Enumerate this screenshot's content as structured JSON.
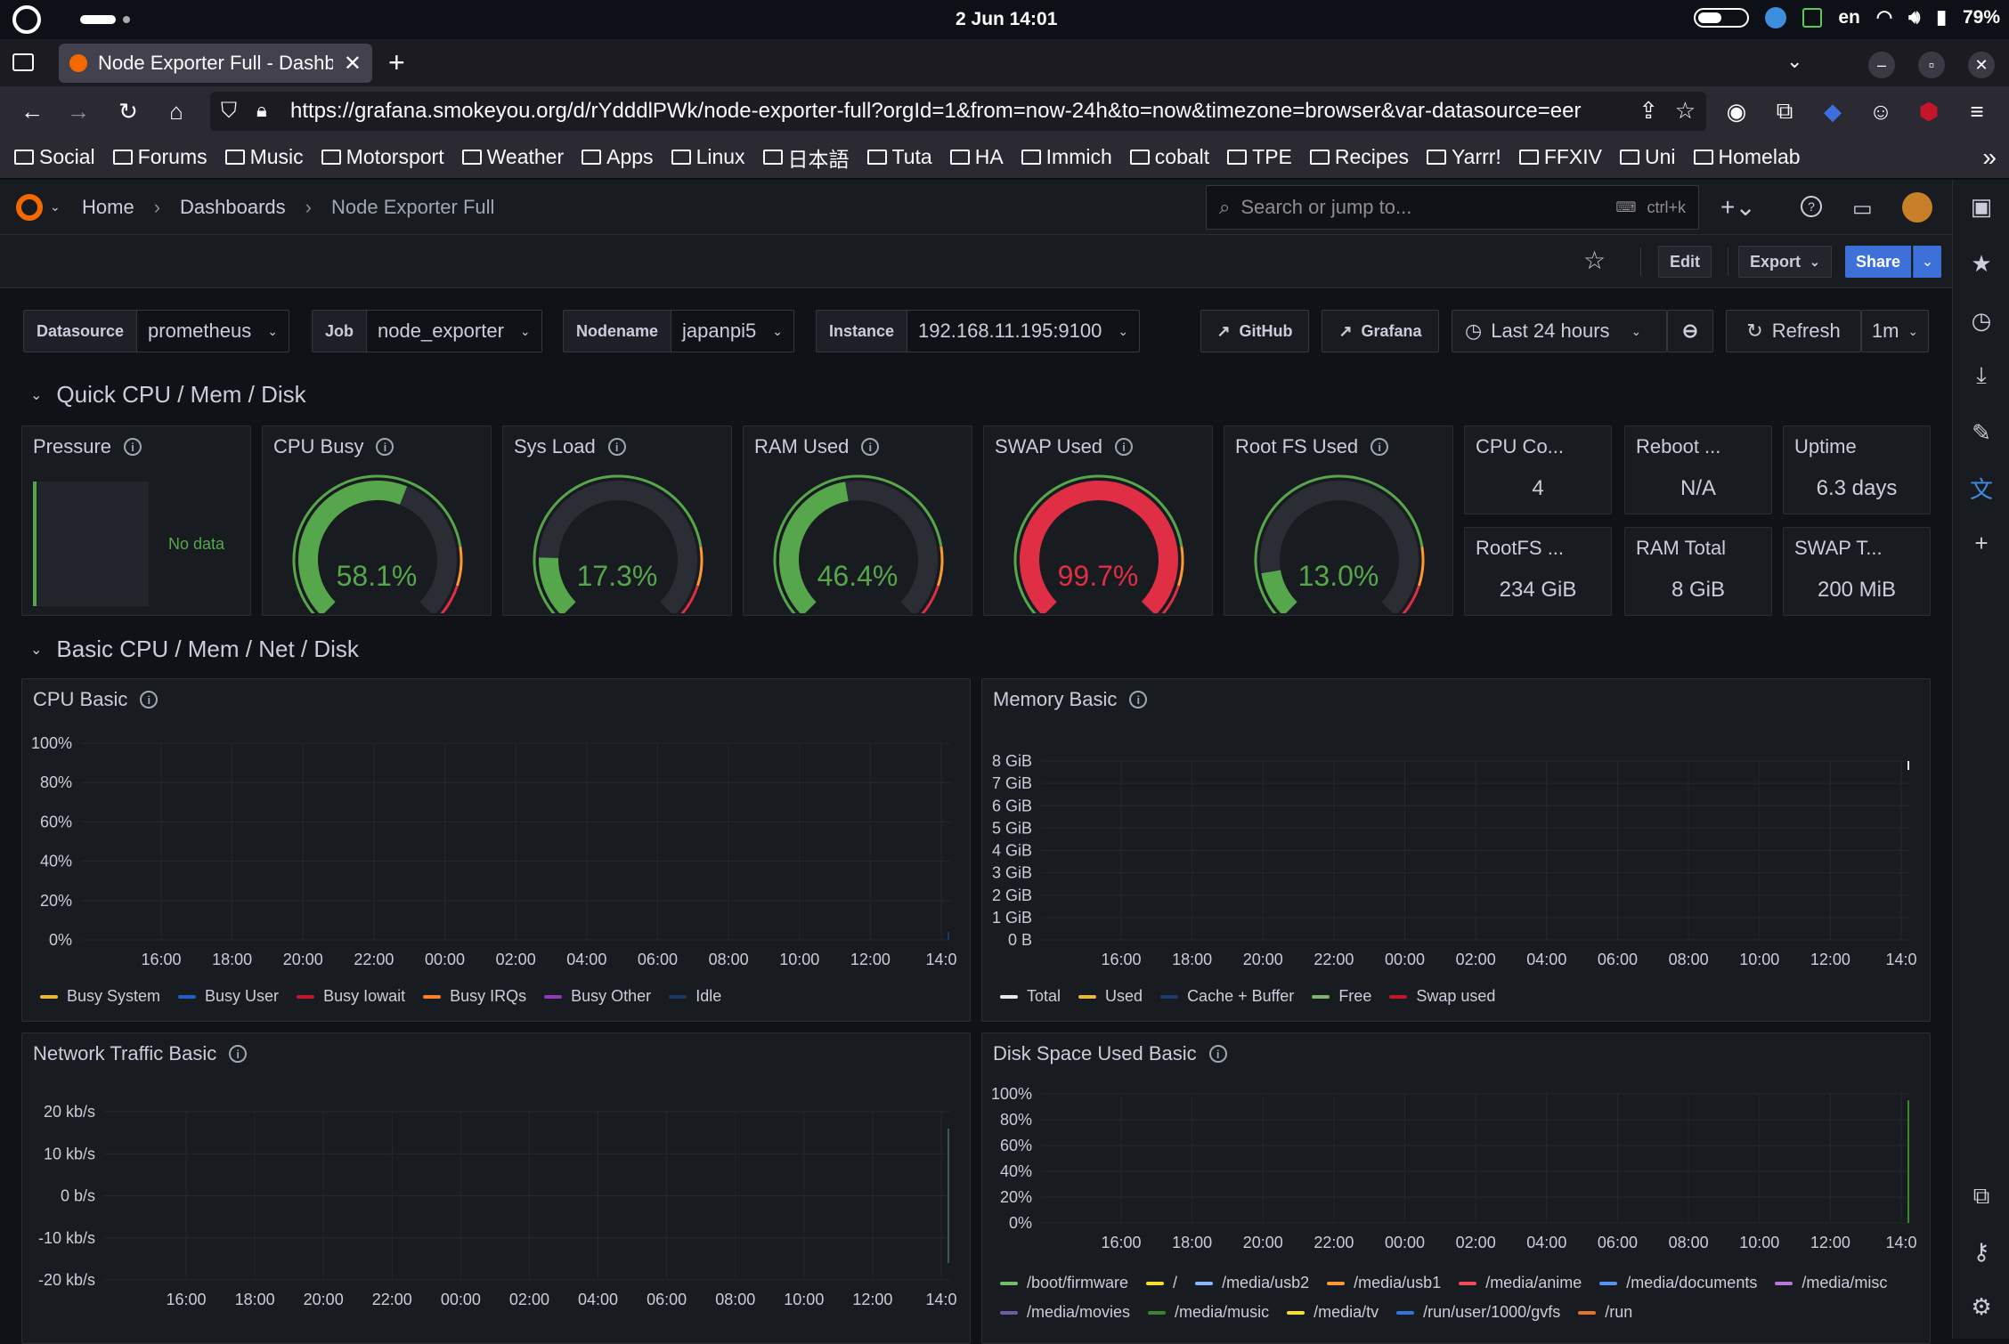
{
  "os": {
    "clock": "2 Jun  14:01",
    "lang": "en",
    "battery": "79%"
  },
  "browser": {
    "tab_title": "Node Exporter Full - Dashb",
    "url": "https://grafana.smokeyou.org/d/rYdddlPWk/node-exporter-full?orgId=1&from=now-24h&to=now&timezone=browser&var-datasource=eer",
    "bookmarks": [
      "Social",
      "Forums",
      "Music",
      "Motorsport",
      "Weather",
      "Apps",
      "Linux",
      "日本語",
      "Tuta",
      "HA",
      "Immich",
      "cobalt",
      "TPE",
      "Recipes",
      "Yarrr!",
      "FFXIV",
      "Uni",
      "Homelab"
    ]
  },
  "grafana": {
    "breadcrumb": [
      "Home",
      "Dashboards",
      "Node Exporter Full"
    ],
    "search_placeholder": "Search or jump to...",
    "search_shortcut": "ctrl+k",
    "edit_label": "Edit",
    "export_label": "Export",
    "share_label": "Share"
  },
  "variables": [
    {
      "label": "Datasource",
      "value": "prometheus"
    },
    {
      "label": "Job",
      "value": "node_exporter"
    },
    {
      "label": "Nodename",
      "value": "japanpi5"
    },
    {
      "label": "Instance",
      "value": "192.168.11.195:9100"
    }
  ],
  "links": {
    "github": "GitHub",
    "grafana": "Grafana"
  },
  "timepicker": {
    "range": "Last 24 hours",
    "refresh": "Refresh",
    "interval": "1m"
  },
  "rows": {
    "quick": "Quick CPU / Mem / Disk",
    "basic": "Basic CPU / Mem / Net / Disk"
  },
  "panels": {
    "pressure": {
      "title": "Pressure",
      "no_data": "No data"
    },
    "gauges": [
      {
        "title": "CPU Busy",
        "value": "58.1%",
        "fraction": 0.581,
        "color": "#56a64b"
      },
      {
        "title": "Sys Load",
        "value": "17.3%",
        "fraction": 0.173,
        "color": "#56a64b"
      },
      {
        "title": "RAM Used",
        "value": "46.4%",
        "fraction": 0.464,
        "color": "#56a64b"
      },
      {
        "title": "SWAP Used",
        "value": "99.7%",
        "fraction": 0.997,
        "color": "#e02f44"
      },
      {
        "title": "Root FS Used",
        "value": "13.0%",
        "fraction": 0.13,
        "color": "#56a64b"
      }
    ],
    "stats": [
      {
        "title": "CPU Co...",
        "value": "4"
      },
      {
        "title": "Reboot ...",
        "value": "N/A"
      },
      {
        "title": "Uptime",
        "value": "6.3 days"
      },
      {
        "title": "RootFS ...",
        "value": "234 GiB"
      },
      {
        "title": "RAM Total",
        "value": "8 GiB"
      },
      {
        "title": "SWAP T...",
        "value": "200 MiB"
      }
    ],
    "cpu_basic": {
      "title": "CPU Basic"
    },
    "memory_basic": {
      "title": "Memory Basic"
    },
    "network_basic": {
      "title": "Network Traffic Basic"
    },
    "disk_basic": {
      "title": "Disk Space Used Basic"
    }
  },
  "chart_data": [
    {
      "type": "line",
      "title": "CPU Basic",
      "x": [
        "16:00",
        "18:00",
        "20:00",
        "22:00",
        "00:00",
        "02:00",
        "04:00",
        "06:00",
        "08:00",
        "10:00",
        "12:00",
        "14:0"
      ],
      "yticks": [
        "100%",
        "80%",
        "60%",
        "40%",
        "20%",
        "0%"
      ],
      "series": [
        {
          "name": "Busy System",
          "color": "#eab839",
          "values": []
        },
        {
          "name": "Busy User",
          "color": "#1f60c4",
          "values": []
        },
        {
          "name": "Busy Iowait",
          "color": "#c4162a",
          "values": []
        },
        {
          "name": "Busy IRQs",
          "color": "#ff7f2a",
          "values": []
        },
        {
          "name": "Busy Other",
          "color": "#8f3bb8",
          "values": []
        },
        {
          "name": "Idle",
          "color": "#1a3a66",
          "values": []
        }
      ]
    },
    {
      "type": "line",
      "title": "Memory Basic",
      "x": [
        "16:00",
        "18:00",
        "20:00",
        "22:00",
        "00:00",
        "02:00",
        "04:00",
        "06:00",
        "08:00",
        "10:00",
        "12:00",
        "14:0"
      ],
      "yticks": [
        "8 GiB",
        "7 GiB",
        "6 GiB",
        "5 GiB",
        "4 GiB",
        "3 GiB",
        "2 GiB",
        "1 GiB",
        "0 B"
      ],
      "series": [
        {
          "name": "Total",
          "color": "#e6e6e6",
          "values": []
        },
        {
          "name": "Used",
          "color": "#eab839",
          "values": []
        },
        {
          "name": "Cache + Buffer",
          "color": "#1f3a6e",
          "values": []
        },
        {
          "name": "Free",
          "color": "#7eb26d",
          "values": []
        },
        {
          "name": "Swap used",
          "color": "#c4162a",
          "values": []
        }
      ]
    },
    {
      "type": "line",
      "title": "Network Traffic Basic",
      "x": [
        "16:00",
        "18:00",
        "20:00",
        "22:00",
        "00:00",
        "02:00",
        "04:00",
        "06:00",
        "08:00",
        "10:00",
        "12:00",
        "14:0"
      ],
      "yticks": [
        "20 kb/s",
        "10 kb/s",
        "0 b/s",
        "-10 kb/s",
        "-20 kb/s"
      ],
      "series": []
    },
    {
      "type": "line",
      "title": "Disk Space Used Basic",
      "x": [
        "16:00",
        "18:00",
        "20:00",
        "22:00",
        "00:00",
        "02:00",
        "04:00",
        "06:00",
        "08:00",
        "10:00",
        "12:00",
        "14:0"
      ],
      "yticks": [
        "100%",
        "80%",
        "60%",
        "40%",
        "20%",
        "0%"
      ],
      "series": [
        {
          "name": "/boot/firmware",
          "color": "#73bf69",
          "values": []
        },
        {
          "name": "/",
          "color": "#fade2a",
          "values": []
        },
        {
          "name": "/media/usb2",
          "color": "#8ab8ff",
          "values": []
        },
        {
          "name": "/media/usb1",
          "color": "#ff9830",
          "values": []
        },
        {
          "name": "/media/anime",
          "color": "#f2495c",
          "values": []
        },
        {
          "name": "/media/documents",
          "color": "#5794f2",
          "values": []
        },
        {
          "name": "/media/misc",
          "color": "#b877d9",
          "values": []
        },
        {
          "name": "/media/movies",
          "color": "#705da0",
          "values": []
        },
        {
          "name": "/media/music",
          "color": "#37872d",
          "values": []
        },
        {
          "name": "/media/tv",
          "color": "#fade2a",
          "values": []
        },
        {
          "name": "/run/user/1000/gvfs",
          "color": "#3274d9",
          "values": []
        },
        {
          "name": "/run",
          "color": "#e0752d",
          "values": []
        }
      ]
    }
  ]
}
